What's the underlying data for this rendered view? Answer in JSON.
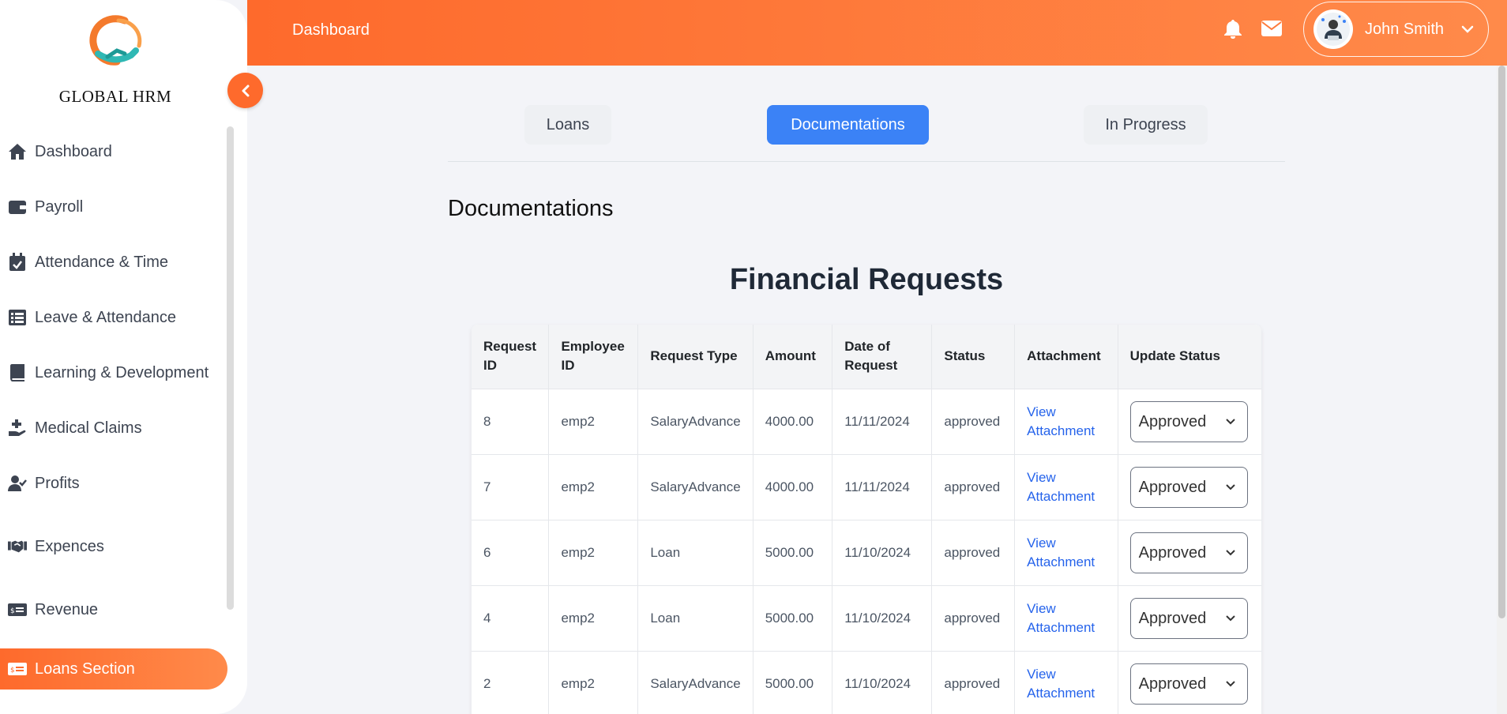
{
  "brand": {
    "name": "GLOBAL HRM",
    "logo_icon": "handshake-logo"
  },
  "sidebar": {
    "items": [
      {
        "label": "Dashboard",
        "icon": "home-icon"
      },
      {
        "label": "Payroll",
        "icon": "wallet-icon"
      },
      {
        "label": "Attendance & Time",
        "icon": "calendar-check-icon"
      },
      {
        "label": "Leave & Attendance",
        "icon": "list-icon"
      },
      {
        "label": "Learning & Development",
        "icon": "book-icon"
      },
      {
        "label": "Medical Claims",
        "icon": "hand-medical-icon"
      },
      {
        "label": "Profits",
        "icon": "user-check-icon"
      },
      {
        "label": "Expences",
        "icon": "handshake-icon"
      },
      {
        "label": "Revenue",
        "icon": "money-check-icon"
      },
      {
        "label": "Loans Section",
        "icon": "money-check-icon",
        "active": true
      }
    ]
  },
  "header": {
    "title": "Dashboard",
    "user_name": "John Smith",
    "icons": [
      "bell-icon",
      "envelope-icon",
      "chevron-down-icon"
    ]
  },
  "tabs": [
    {
      "label": "Loans"
    },
    {
      "label": "Documentations",
      "active": true
    },
    {
      "label": "In Progress"
    }
  ],
  "section_title": "Documentations",
  "table": {
    "title": "Financial Requests",
    "columns": [
      {
        "label": "Request ID"
      },
      {
        "label": "Employee ID"
      },
      {
        "label": "Request Type"
      },
      {
        "label": "Amount"
      },
      {
        "label": "Date of Request"
      },
      {
        "label": "Status"
      },
      {
        "label": "Attachment"
      },
      {
        "label": "Update Status"
      }
    ],
    "rows": [
      {
        "id": "8",
        "employee": "emp2",
        "type": "SalaryAdvance",
        "amount": "4000.00",
        "date": "11/11/2024",
        "status": "approved",
        "attachment": "View Attachment",
        "update": "Approved"
      },
      {
        "id": "7",
        "employee": "emp2",
        "type": "SalaryAdvance",
        "amount": "4000.00",
        "date": "11/11/2024",
        "status": "approved",
        "attachment": "View Attachment",
        "update": "Approved"
      },
      {
        "id": "6",
        "employee": "emp2",
        "type": "Loan",
        "amount": "5000.00",
        "date": "11/10/2024",
        "status": "approved",
        "attachment": "View Attachment",
        "update": "Approved"
      },
      {
        "id": "4",
        "employee": "emp2",
        "type": "Loan",
        "amount": "5000.00",
        "date": "11/10/2024",
        "status": "approved",
        "attachment": "View Attachment",
        "update": "Approved"
      },
      {
        "id": "2",
        "employee": "emp2",
        "type": "SalaryAdvance",
        "amount": "5000.00",
        "date": "11/10/2024",
        "status": "approved",
        "attachment": "View Attachment",
        "update": "Approved"
      }
    ]
  },
  "colors": {
    "accent": "#fe6a2c",
    "primary": "#3b82f6",
    "link": "#2563eb"
  }
}
